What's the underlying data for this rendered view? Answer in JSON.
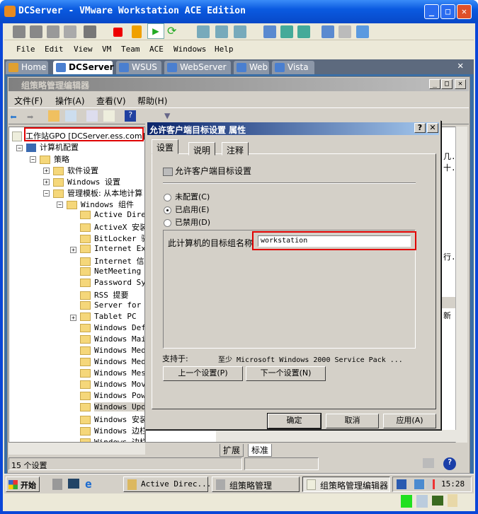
{
  "window": {
    "title": "DCServer - VMware Workstation ACE Edition"
  },
  "menu": [
    "File",
    "Edit",
    "View",
    "VM",
    "Team",
    "ACE",
    "Windows",
    "Help"
  ],
  "vm_tabs": [
    {
      "label": "Home"
    },
    {
      "label": "DCServer",
      "active": true
    },
    {
      "label": "WSUS"
    },
    {
      "label": "WebServer"
    },
    {
      "label": "Web"
    },
    {
      "label": "Vista"
    }
  ],
  "gpme": {
    "title": "组策略管理编辑器",
    "menu": [
      "文件(F)",
      "操作(A)",
      "查看(V)",
      "帮助(H)"
    ]
  },
  "tree": {
    "root": "工作站GPO [DCServer.ess.com]",
    "computer": "计算机配置",
    "policy": "策略",
    "software": "软件设置",
    "windows_settings": "Windows 设置",
    "admin": "管理模板: 从本地计算",
    "components": "Windows 组件",
    "items": [
      "Active Direct",
      "ActiveX 安装Ŧ",
      "BitLocker 驱动",
      "Internet Expl",
      "Internet 信息",
      "NetMeeting",
      "Password Sync",
      "RSS 提要",
      "Server for NI",
      "Tablet PC",
      "Windows Defer",
      "Windows Mail",
      "Windows Medi",
      "Windows Medi",
      "Windows Messe",
      "Windows Movie",
      "Windows Power",
      "Windows Upda",
      "Windows 安装",
      "Windows 边栏",
      "Windows 边栏显示"
    ],
    "selected_index": 17
  },
  "right_pane": {
    "fragments": [
      "几...",
      "十...",
      "行...",
      "新"
    ]
  },
  "bottom_tabs": [
    "扩展",
    "标准"
  ],
  "dialog": {
    "title": "允许客户端目标设置 属性",
    "tabs": [
      "设置",
      "说明",
      "注释"
    ],
    "setting_name": "允许客户端目标设置",
    "options": [
      {
        "label": "未配置(C)",
        "checked": false
      },
      {
        "label": "已启用(E)",
        "checked": true
      },
      {
        "label": "已禁用(D)",
        "checked": false
      }
    ],
    "field_label": "此计算机的目标组名称",
    "field_value": "workstation",
    "supported_label": "支持于:",
    "supported_value": "至少 Microsoft Windows 2000 Service Pack ...",
    "prev": "上一个设置(P)",
    "next": "下一个设置(N)",
    "ok": "确定",
    "cancel": "取消",
    "apply": "应用(A)"
  },
  "status": {
    "text": "15 个设置"
  },
  "taskbar": {
    "start": "开始",
    "buttons": [
      "Active Direc...",
      "组策略管理",
      "组策略管理编辑器"
    ],
    "clock": "15:28"
  },
  "colors": {
    "xp_blue": "#0a46d8",
    "highlight": "#e00000",
    "dialog_title": "#0a246a"
  }
}
